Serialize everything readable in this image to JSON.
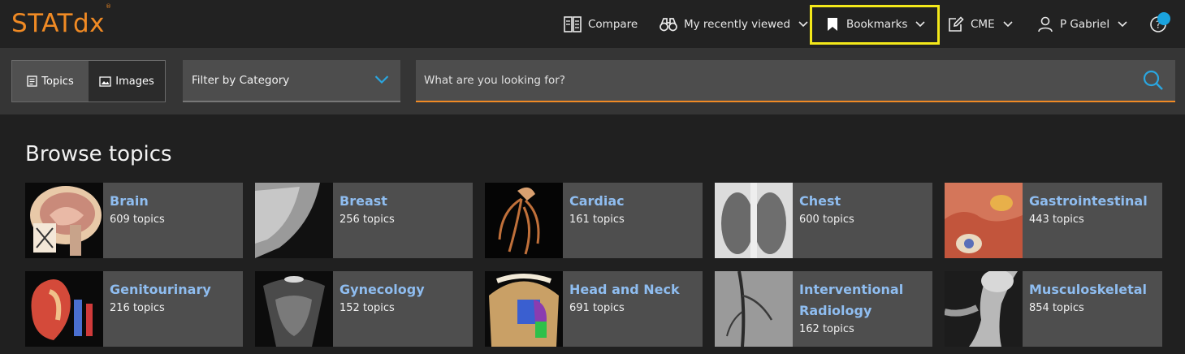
{
  "app": {
    "logo": "STATdx",
    "logo_mark": "®"
  },
  "header": {
    "compare": "Compare",
    "recently_viewed": "My recently viewed",
    "bookmarks": "Bookmarks",
    "cme": "CME",
    "user": "P Gabriel"
  },
  "search_bar": {
    "toggle_topics": "Topics",
    "toggle_images": "Images",
    "filter_label": "Filter by Category",
    "search_placeholder": "What are you looking for?"
  },
  "browse": {
    "title": "Browse topics",
    "topics": [
      {
        "name": "Brain",
        "count": "609 topics"
      },
      {
        "name": "Breast",
        "count": "256 topics"
      },
      {
        "name": "Cardiac",
        "count": "161 topics"
      },
      {
        "name": "Chest",
        "count": "600 topics"
      },
      {
        "name": "Gastrointestinal",
        "count": "443 topics"
      },
      {
        "name": "Genitourinary",
        "count": "216 topics"
      },
      {
        "name": "Gynecology",
        "count": "152 topics"
      },
      {
        "name": "Head and Neck",
        "count": "691 topics"
      },
      {
        "name": "Interventional Radiology",
        "count": "162 topics"
      },
      {
        "name": "Musculoskeletal",
        "count": "854 topics"
      }
    ]
  },
  "colors": {
    "accent": "#f08a24",
    "link": "#8fbdf0",
    "highlight": "#f3e81a",
    "notification": "#1aa3de"
  }
}
